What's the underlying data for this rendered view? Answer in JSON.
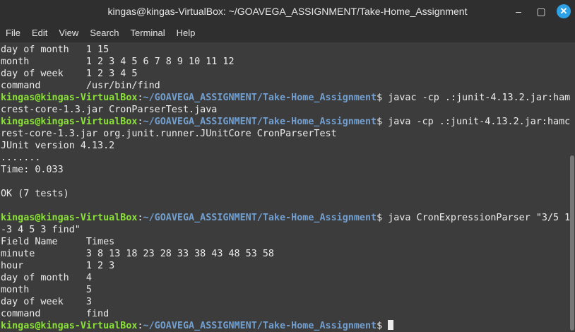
{
  "window": {
    "title": "kingas@kingas-VirtualBox: ~/GOAVEGA_ASSIGNMENT/Take-Home_Assignment",
    "minimize_icon": "–",
    "maximize_icon": "▢",
    "close_icon": "✕"
  },
  "menu": {
    "file": "File",
    "edit": "Edit",
    "view": "View",
    "search": "Search",
    "terminal": "Terminal",
    "help": "Help"
  },
  "prompt": {
    "user": "kingas@kingas-VirtualBox",
    "colon": ":",
    "path": "~/GOAVEGA_ASSIGNMENT/Take-Home_Assignment",
    "dollar": "$"
  },
  "lines": [
    {
      "text": "day of month   1 15"
    },
    {
      "text": "month          1 2 3 4 5 6 7 8 9 10 11 12"
    },
    {
      "text": "day of week    1 2 3 4 5"
    },
    {
      "text": "command        /usr/bin/find"
    },
    {
      "prompt": true,
      "cmd": " javac -cp .:junit-4.13.2.jar:ham"
    },
    {
      "text": "crest-core-1.3.jar CronParserTest.java"
    },
    {
      "prompt": true,
      "cmd": " java -cp .:junit-4.13.2.jar:hamc"
    },
    {
      "text": "rest-core-1.3.jar org.junit.runner.JUnitCore CronParserTest"
    },
    {
      "text": "JUnit version 4.13.2"
    },
    {
      "text": "......."
    },
    {
      "text": "Time: 0.033"
    },
    {
      "text": ""
    },
    {
      "text": "OK (7 tests)"
    },
    {
      "text": ""
    },
    {
      "prompt": true,
      "cmd": " java CronExpressionParser \"3/5 1"
    },
    {
      "text": "-3 4 5 3 find\""
    },
    {
      "text": "Field Name     Times"
    },
    {
      "text": "minute         3 8 13 18 23 28 33 38 43 48 53 58"
    },
    {
      "text": "hour           1 2 3"
    },
    {
      "text": "day of month   4"
    },
    {
      "text": "month          5"
    },
    {
      "text": "day of week    3"
    },
    {
      "text": "command        find"
    },
    {
      "prompt": true,
      "cmd": " ",
      "cursor": true
    }
  ]
}
